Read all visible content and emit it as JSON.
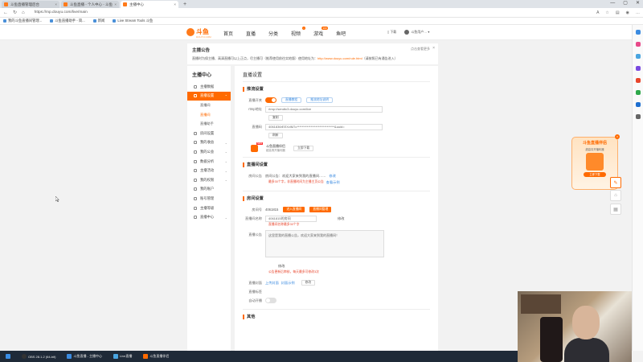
{
  "browser": {
    "tabs": [
      {
        "title": "斗鱼直播管理后台"
      },
      {
        "title": "斗鱼直播 - 个人中心 - 斗鱼"
      },
      {
        "title": "主播中心"
      }
    ],
    "url": "https://mp.douyu.com/live/main",
    "bookmarks": [
      "我的斗鱼直播间管理...",
      "斗鱼直播助手 - 简...",
      "新闻",
      "Live Stream Tools 斗鱼"
    ]
  },
  "topnav": {
    "logo": "斗鱼",
    "logo_sub": "DOUYU.COM",
    "menu": [
      {
        "label": "首页",
        "badge": ""
      },
      {
        "label": "直播",
        "badge": ""
      },
      {
        "label": "分类",
        "badge": ""
      },
      {
        "label": "视频",
        "badge": "•"
      },
      {
        "label": "游戏",
        "badge": "200"
      },
      {
        "label": "鱼吧",
        "badge": ""
      }
    ],
    "download": "下载",
    "username": "斗鱼用户…"
  },
  "announce": {
    "title": "主播公告",
    "text": "直播时为保主播、高清直播可以上正点，尽主播可（推荐使用前往实地版）使用地址为：",
    "link": "http://www.douyu.com/rule.html",
    "suffix": "（请按照已有通告进入）",
    "more": "点击查看更多",
    "close": "×"
  },
  "sidebar": {
    "title": "主播中心",
    "items": [
      {
        "label": "主播数据",
        "chev": ""
      },
      {
        "label": "直播设置",
        "chev": "^",
        "active": true
      },
      {
        "label": "直播间",
        "sub": true
      },
      {
        "label": "直播间",
        "sub": true,
        "current": true
      },
      {
        "label": "直播助手",
        "sub": true
      },
      {
        "label": "房间设置",
        "chev": ""
      },
      {
        "label": "我的收益",
        "chev": "v"
      },
      {
        "label": "我的公会",
        "chev": "v"
      },
      {
        "label": "数据分析",
        "chev": "v"
      },
      {
        "label": "主播活动",
        "chev": "v"
      },
      {
        "label": "我的权限",
        "chev": "v"
      },
      {
        "label": "我的账户",
        "chev": ""
      },
      {
        "label": "账号管理",
        "chev": ""
      },
      {
        "label": "主播等级",
        "chev": ""
      },
      {
        "label": "直播中心",
        "chev": "v"
      }
    ]
  },
  "main": {
    "page_title": "直播设置",
    "push": {
      "title": "推流设置",
      "toggle_label": "直播开关",
      "btn1": "直播教程",
      "btn2": "推流地址说明",
      "rtmp_label": "rtmp地址",
      "rtmp_value": "rtmp://sendtc3.douyu.com/live",
      "copy": "复制",
      "key_label": "直播码",
      "key_value": "4061836rEEXvlM7c******************************&uuid=",
      "refresh": "刷新",
      "tool_name": "斗鱼直播伴侣",
      "tool_new": "NEW",
      "tool_desc": "超高清开播利器",
      "tool_btn": "立即下载"
    },
    "room": {
      "title": "直播间设置",
      "label": "房间公告",
      "text": "房间公告：欢迎大家来到我的直播间……",
      "edit": "修改",
      "hint": "最多30个字，非直播时间为主播主页公告",
      "hint_link": "查看示例"
    },
    "info": {
      "title": "房间设置",
      "id_label": "房间号",
      "id_value": "4061815",
      "btn_a": "进入直播间",
      "btn_b": "直播间管理",
      "name_label": "直播间名称",
      "name_value": "4061815的房间",
      "name_edit": "修改",
      "name_hint": "直播间名称最多30个字",
      "notice_label": "直播公告",
      "notice_value": "这里是我的直播公告，欢迎大家来到我的直播间！",
      "notice_edit": "修改",
      "notice_hint": "公告更新后审核，每天最多可修改3次",
      "cover_label": "直播封面",
      "cover_link": "上传封面",
      "cover_link2": "封面示例",
      "cover_btn": "修改",
      "tag_label": "直播标签",
      "auto_label": "自动开播"
    },
    "other": {
      "title": "其他"
    }
  },
  "ad": {
    "title": "斗鱼直播伴侣",
    "desc": "超高清开播利器",
    "btn": "立即下载",
    "close": "×"
  },
  "taskbar": {
    "items": [
      "OBS 28.1.2 (64-bit)",
      "斗鱼直播 - 主播中心",
      "Live直播",
      "斗鱼直播伴侣"
    ]
  },
  "colors": {
    "accent": "#ff6a00",
    "link": "#3b8be0",
    "warn": "#e8452c"
  }
}
